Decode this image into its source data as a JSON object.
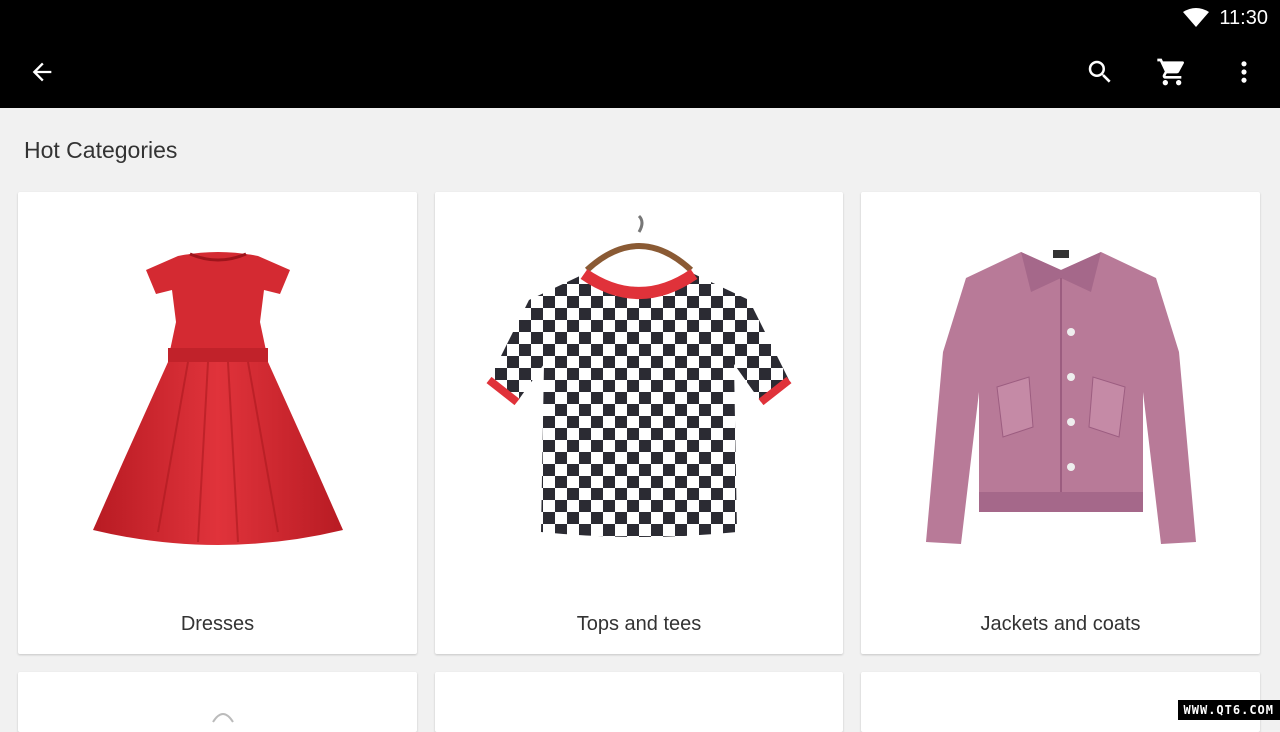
{
  "status_bar": {
    "time": "11:30",
    "icons": [
      "wifi-icon"
    ]
  },
  "toolbar": {
    "back_icon": "arrow-back-icon",
    "actions": [
      "search-icon",
      "cart-icon",
      "more-vertical-icon"
    ]
  },
  "section": {
    "title": "Hot Categories"
  },
  "categories": [
    {
      "label": "Dresses",
      "image": "red-dress"
    },
    {
      "label": "Tops and tees",
      "image": "checkered-tee"
    },
    {
      "label": "Jackets and coats",
      "image": "pink-velvet-jacket"
    }
  ],
  "colors": {
    "appbar": "#000000",
    "background": "#f1f1f1",
    "dress": "#d7262f",
    "tee_trim": "#e0323a",
    "jacket": "#b87a98"
  },
  "watermark": "WWW.QT6.COM"
}
